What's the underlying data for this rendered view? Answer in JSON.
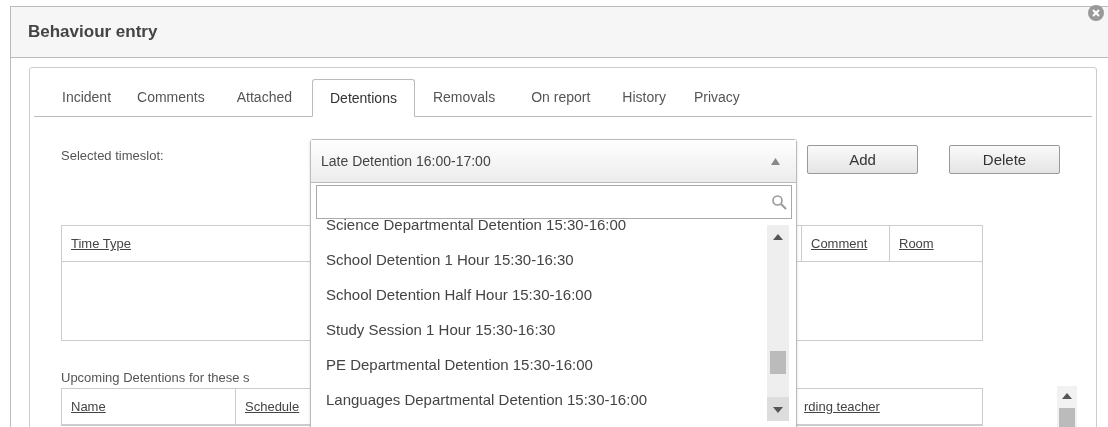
{
  "dialog": {
    "title": "Behaviour entry"
  },
  "tabs": [
    {
      "label": "Incident",
      "selected": false
    },
    {
      "label": "Comments",
      "selected": false
    },
    {
      "label": "Attached",
      "selected": false
    },
    {
      "label": "Detentions",
      "selected": true
    },
    {
      "label": "Removals",
      "selected": false
    },
    {
      "label": "On report",
      "selected": false
    },
    {
      "label": "History",
      "selected": false
    },
    {
      "label": "Privacy",
      "selected": false
    }
  ],
  "timeslot": {
    "label": "Selected timeslot:",
    "value": "Late Detention 16:00-17:00",
    "expanded": true,
    "options": [
      "Science Departmental Detention 15:30-16:00",
      "School Detention 1 Hour 15:30-16:30",
      "School Detention Half Hour 15:30-16:00",
      "Study Session 1 Hour 15:30-16:30",
      "PE Departmental Detention 15:30-16:00",
      "Languages Departmental Detention 15:30-16:00"
    ]
  },
  "buttons": [
    "Add",
    "Delete"
  ],
  "time_table": {
    "columns": [
      "Time Type",
      "Comment",
      "Room"
    ]
  },
  "upcoming": {
    "label": "Upcoming Detentions for these s",
    "columns": [
      "Name",
      "Schedule",
      "rding teacher"
    ]
  }
}
